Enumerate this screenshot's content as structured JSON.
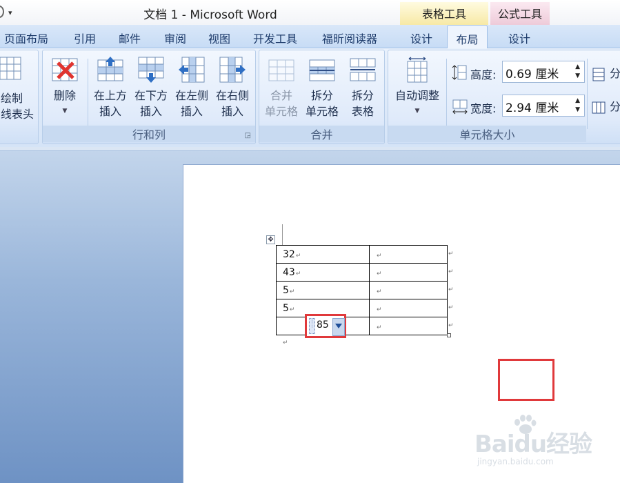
{
  "window": {
    "title": "文档 1 - Microsoft Word"
  },
  "context_groups": {
    "table_tools": "表格工具",
    "formula_tools": "公式工具"
  },
  "tabs": {
    "page_layout": "页面布局",
    "references": "引用",
    "mailings": "邮件",
    "review": "审阅",
    "view": "视图",
    "developer": "开发工具",
    "foxit_reader": "福昕阅读器",
    "table_design": "设计",
    "table_layout": "布局",
    "formula_design": "设计"
  },
  "ribbon": {
    "draw_group": {
      "draw_line1": "绘制",
      "draw_line2": "线表头"
    },
    "rows_cols": {
      "label": "行和列",
      "delete": "删除",
      "insert_above_1": "在上方",
      "insert_above_2": "插入",
      "insert_below_1": "在下方",
      "insert_below_2": "插入",
      "insert_left_1": "在左侧",
      "insert_left_2": "插入",
      "insert_right_1": "在右侧",
      "insert_right_2": "插入"
    },
    "merge": {
      "label": "合并",
      "merge_cells_1": "合并",
      "merge_cells_2": "单元格",
      "split_cells_1": "拆分",
      "split_cells_2": "单元格",
      "split_table_1": "拆分",
      "split_table_2": "表格"
    },
    "cell_size": {
      "label": "单元格大小",
      "autofit": "自动调整",
      "height_label": "高度:",
      "height_value": "0.69 厘米",
      "width_label": "宽度:",
      "width_value": "2.94 厘米",
      "distribute_rows": "分",
      "distribute_cols": "分"
    }
  },
  "document": {
    "table_rows": [
      [
        "32",
        ""
      ],
      [
        "43",
        ""
      ],
      [
        "5",
        ""
      ],
      [
        "5",
        ""
      ],
      [
        "",
        ""
      ]
    ],
    "field_value": "85",
    "paragraph_mark": "↵"
  },
  "watermark": {
    "brand": "Baidu经验",
    "url": "jingyan.baidu.com"
  },
  "colors": {
    "highlight": "#e0393b",
    "ribbon_tab": "#d9e7f9"
  }
}
